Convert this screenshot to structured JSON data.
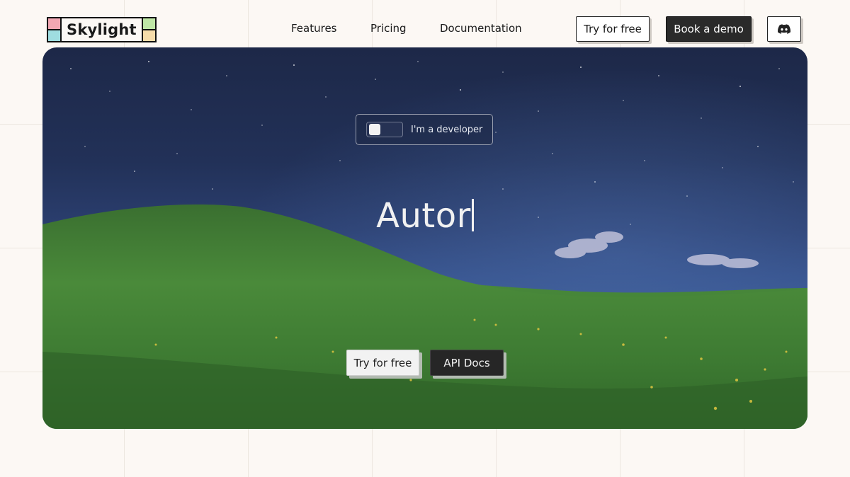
{
  "brand": {
    "name": "Skylight"
  },
  "nav": {
    "items": [
      "Features",
      "Pricing",
      "Documentation"
    ]
  },
  "header": {
    "try_label": "Try for free",
    "demo_label": "Book a demo",
    "discord_icon": "discord-icon"
  },
  "hero": {
    "toggle_label": "I'm a developer",
    "toggle_on": false,
    "headline": "Autor",
    "primary_cta": "Try for free",
    "secondary_cta": "API Docs"
  },
  "colors": {
    "page_bg": "#fcf8f4",
    "dark_button": "#2a2a2a",
    "sky": "#223158",
    "grass": "#3f7a35"
  }
}
